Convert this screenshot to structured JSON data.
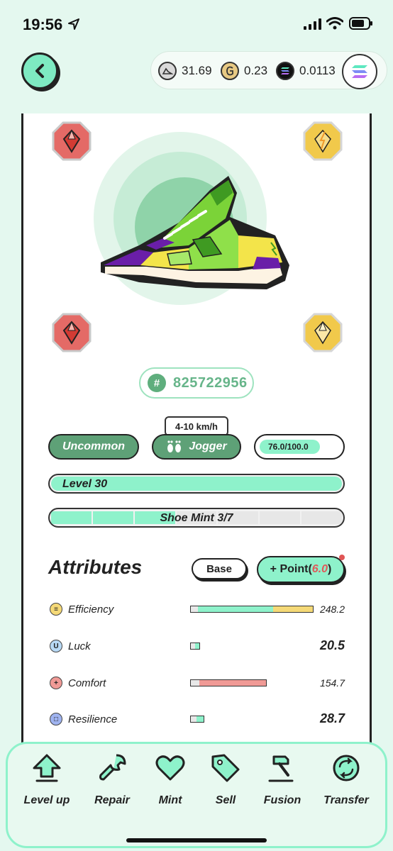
{
  "status_bar": {
    "time": "19:56"
  },
  "balances": {
    "gst": "31.69",
    "gmt": "0.23",
    "sol": "0.0113"
  },
  "sneaker": {
    "id": "825722956",
    "rarity": "Uncommon",
    "type": "Jogger",
    "speed_range": "4-10 km/h",
    "durability": "76.0/100.0",
    "durability_fraction": 0.76,
    "level_label": "Level 30",
    "level_fraction": 1.0,
    "mint_label": "Shoe Mint 3/7",
    "mint_used": 3,
    "mint_total": 7
  },
  "attributes": {
    "title": "Attributes",
    "base_label": "Base",
    "point_label": "+ Point(",
    "point_value": "6.0",
    "point_close": ")",
    "rows": [
      {
        "name": "Efficiency",
        "value": "248.2",
        "icon": "efficiency-icon",
        "color": "#f5d977"
      },
      {
        "name": "Luck",
        "value": "20.5",
        "icon": "luck-icon",
        "color": "#b8d9f5"
      },
      {
        "name": "Comfort",
        "value": "154.7",
        "icon": "comfort-icon",
        "color": "#f09a96"
      },
      {
        "name": "Resilience",
        "value": "28.7",
        "icon": "resilience-icon",
        "color": "#9fb3f0"
      }
    ]
  },
  "actions": [
    {
      "label": "Level up",
      "icon": "level-up-icon"
    },
    {
      "label": "Repair",
      "icon": "wrench-icon"
    },
    {
      "label": "Mint",
      "icon": "heart-icon"
    },
    {
      "label": "Sell",
      "icon": "tag-icon"
    },
    {
      "label": "Fusion",
      "icon": "hammer-icon"
    },
    {
      "label": "Transfer",
      "icon": "transfer-icon"
    }
  ],
  "colors": {
    "accent": "#8ef2cb",
    "dark_green": "#5ea177",
    "gem_red": "#e46a66",
    "gem_yellow": "#f1c94b"
  }
}
